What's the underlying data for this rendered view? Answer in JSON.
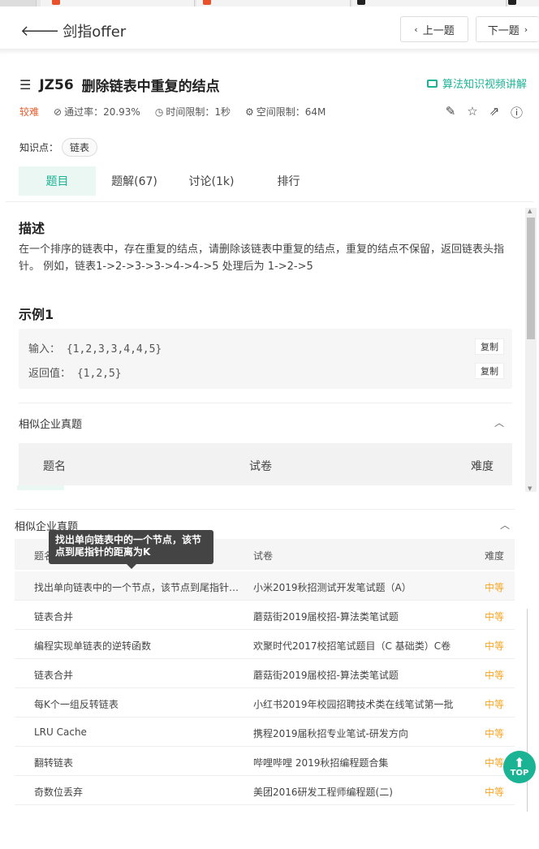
{
  "colors": {
    "accent": "#1ab394",
    "hard": "#e85d2c",
    "medium": "#f5a623"
  },
  "header": {
    "back_label": "剑指offer",
    "prev_label": "上一题",
    "next_label": "下一题"
  },
  "problem": {
    "id": "JZ56",
    "title": "删除链表中重复的结点",
    "video_link": "算法知识视频讲解",
    "difficulty": "较难",
    "pass_rate": "通过率：20.93%",
    "time_limit": "时间限制：1秒",
    "space_limit": "空间限制：64M",
    "knowledge_label": "知识点：",
    "knowledge_tag": "链表"
  },
  "tabs": [
    "题目",
    "题解(67)",
    "讨论(1k)",
    "排行"
  ],
  "description": {
    "heading": "描述",
    "text": "在一个排序的链表中，存在重复的结点，请删除该链表中重复的结点，重复的结点不保留，返回链表头指针。 例如，链表1->2->3->3->4->4->5 处理后为 1->2->5"
  },
  "example": {
    "heading": "示例1",
    "input_label": "输入：",
    "input_value": "{1,2,3,3,4,4,5}",
    "output_label": "返回值：",
    "output_value": "{1,2,5}",
    "copy_label": "复制"
  },
  "similar": {
    "heading": "相似企业真题",
    "col_name": "题名",
    "col_paper": "试卷",
    "col_difficulty": "难度",
    "tooltip": "找出单向链表中的一个节点，该节点到尾指针的距离为K",
    "rows": [
      {
        "name": "找出单向链表中的一个节点，该节点到尾指针的距离为K",
        "paper": "小米2019秋招测试开发笔试题（A）",
        "difficulty": "中等"
      },
      {
        "name": "链表合并",
        "paper": "蘑菇街2019届校招-算法类笔试题",
        "difficulty": "中等"
      },
      {
        "name": "编程实现单链表的逆转函数",
        "paper": "欢聚时代2017校招笔试题目（C 基础类）C卷",
        "difficulty": "中等"
      },
      {
        "name": "链表合并",
        "paper": "蘑菇街2019届校招-算法类笔试题",
        "difficulty": "中等"
      },
      {
        "name": "每K个一组反转链表",
        "paper": "小红书2019年校园招聘技术类在线笔试第一批",
        "difficulty": "中等"
      },
      {
        "name": "LRU Cache",
        "paper": "携程2019届秋招专业笔试-研发方向",
        "difficulty": "中等"
      },
      {
        "name": "翻转链表",
        "paper": "哔哩哔哩 2019秋招编程题合集",
        "difficulty": "中等"
      },
      {
        "name": "奇数位丢弃",
        "paper": "美团2016研发工程师编程题(二)",
        "difficulty": "中等"
      }
    ]
  },
  "top_button": "TOP"
}
